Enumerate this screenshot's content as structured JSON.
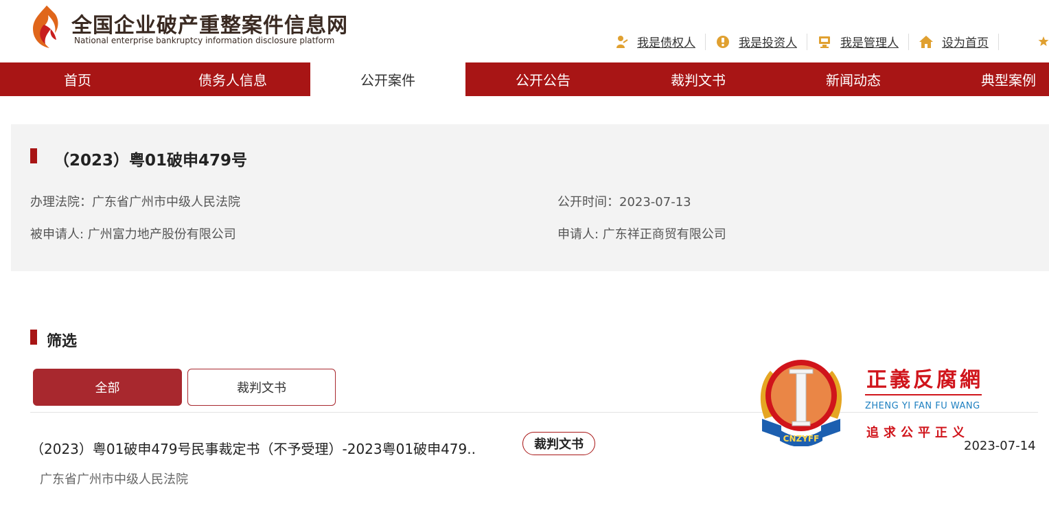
{
  "header": {
    "title": "全国企业破产重整案件信息网",
    "subtitle": "National enterprise bankruptcy  information disclosure platform",
    "links": [
      {
        "label": "我是债权人",
        "icon": "creditor-icon"
      },
      {
        "label": "我是投资人",
        "icon": "investor-icon"
      },
      {
        "label": "我是管理人",
        "icon": "manager-icon"
      },
      {
        "label": "设为首页",
        "icon": "home-icon"
      }
    ]
  },
  "nav": {
    "items": [
      "首页",
      "债务人信息",
      "公开案件",
      "公开公告",
      "裁判文书",
      "新闻动态",
      "典型案例"
    ],
    "active": "公开案件"
  },
  "case": {
    "title": "（2023）粤01破申479号",
    "court": "办理法院：广东省广州市中级人民法院",
    "publish_time": "公开时间：2023-07-13",
    "respondent": "被申请人: 广州富力地产股份有限公司",
    "applicant": "申请人: 广东祥正商贸有限公司"
  },
  "filter": {
    "title": "筛选",
    "tabs": [
      "全部",
      "裁判文书"
    ],
    "active_tab": "全部"
  },
  "results": [
    {
      "title": "（2023）粤01破申479号民事裁定书（不予受理）-2023粤01破申479..",
      "badge": "裁判文书",
      "date": "2023-07-14",
      "court": "广东省广州市中级人民法院"
    }
  ],
  "watermark": {
    "title": "正義反腐網",
    "pinyin": "ZHENG YI FAN FU WANG",
    "slogan": "追求公平正义",
    "emblem_text": "CNZYFF"
  },
  "colors": {
    "brand_red": "#a81515",
    "tab_active": "#a8282e",
    "panel_bg": "#f3f3f3",
    "watermark_red": "#d0141b",
    "watermark_blue": "#1c7fc0"
  }
}
